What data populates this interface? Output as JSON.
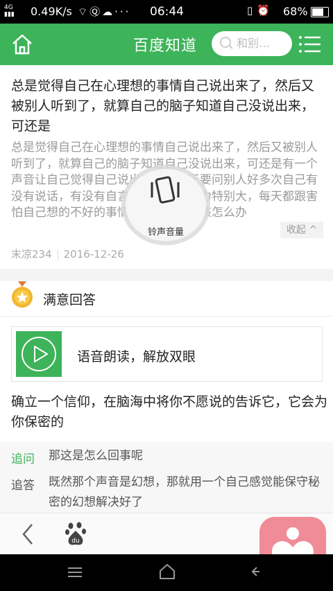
{
  "status_bar": {
    "network": "4G",
    "speed": "0.49K/s",
    "icons_left": [
      "signal-icon",
      "wifi-icon",
      "q-app-icon",
      "cloud-icon",
      "more-icon"
    ],
    "more": "···",
    "time": "06:44",
    "icons_right": [
      "vibrate-icon",
      "alarm-icon"
    ],
    "battery": "68%"
  },
  "header": {
    "title": "百度知道",
    "search_placeholder": "和别…"
  },
  "question": {
    "title": "总是觉得自己在心理想的事情自己说出来了，然后又被别人听到了，就算自己的脑子知道自己没说出来，可还是",
    "body": "总是觉得自己在心理想的事情自己说出来了，然后又被别人听到了，就算自己的脑子知道自己没说出来，可还是有一个声音让自己觉得自己说出来了，每天要问别人好多次自己有没有说话，有没有自言自语，心理压力特别大，每天都跟害怕自己想的不好的事情被别人知道，该怎么办",
    "collapse": "收起",
    "author": "末凉234",
    "date": "2016-12-26"
  },
  "answer": {
    "section_title": "满意回答",
    "voice_label": "语音朗读，解放双眼",
    "text": "确立一个信仰，在脑海中将你不愿说的告诉它，它会为你保密的",
    "followups": [
      {
        "tag": "追问",
        "tag_color": "#3db35a",
        "text": "那这是怎么回事呢"
      },
      {
        "tag": "追答",
        "tag_color": "#555555",
        "text": "既然那个声音是幻想，那就用一个自己感觉能保守秘密的幻想解决好了"
      }
    ]
  },
  "overlay": {
    "label": "铃声音量"
  },
  "colors": {
    "brand_green": "#3db35a",
    "float_app_pink": "#f08c97"
  }
}
